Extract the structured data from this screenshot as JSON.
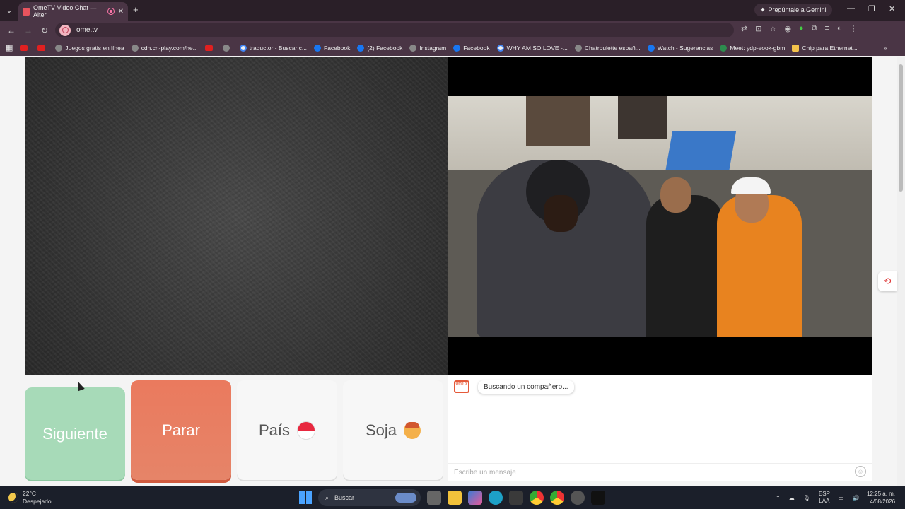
{
  "browser": {
    "tab_title": "OmeTV Video Chat — Alter",
    "gemini_label": "Pregúntale a Gemini",
    "url": "ome.tv",
    "bookmarks": [
      {
        "label": "",
        "icon": "youtube-icon"
      },
      {
        "label": "",
        "icon": "youtube-icon"
      },
      {
        "label": "Juegos gratis en línea",
        "icon": "globe-icon"
      },
      {
        "label": "cdn.cn-play.com/he...",
        "icon": "globe-icon"
      },
      {
        "label": "",
        "icon": "youtube-icon"
      },
      {
        "label": "",
        "icon": "globe-icon"
      },
      {
        "label": "traductor - Buscar c...",
        "icon": "google-icon"
      },
      {
        "label": "Facebook",
        "icon": "facebook-icon"
      },
      {
        "label": "(2) Facebook",
        "icon": "facebook-icon"
      },
      {
        "label": "Instagram",
        "icon": "globe-icon"
      },
      {
        "label": "Facebook",
        "icon": "facebook-icon"
      },
      {
        "label": "WHY AM SO LOVE -...",
        "icon": "google-icon"
      },
      {
        "label": "Chatroulette españ...",
        "icon": "globe-icon"
      },
      {
        "label": "Watch - Sugerencias",
        "icon": "facebook-icon"
      },
      {
        "label": "Meet: ydp-eook-gbm",
        "icon": "meet-icon"
      },
      {
        "label": "Chip para Ethernet...",
        "icon": "bookmark-icon"
      }
    ]
  },
  "controls": {
    "next_label": "Siguiente",
    "stop_label": "Parar",
    "country_label": "País",
    "gender_label": "Soja"
  },
  "chat": {
    "logo_text": "Ome tv",
    "status_message": "Buscando un compañero...",
    "input_placeholder": "Escribe un mensaje"
  },
  "taskbar": {
    "temperature": "22°C",
    "weather": "Despejado",
    "search_label": "Buscar",
    "lang_line1": "ESP",
    "lang_line2": "LAA",
    "time": "12:25 a. m.",
    "date": "4/08/2026"
  }
}
